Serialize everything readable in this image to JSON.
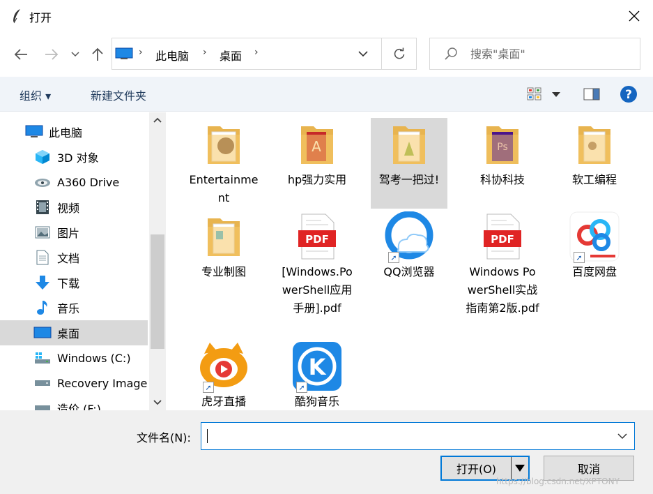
{
  "window": {
    "title": "打开",
    "close_glyph": "✕"
  },
  "address": {
    "crumbs": [
      "此电脑",
      "桌面"
    ],
    "separator": "›"
  },
  "search": {
    "placeholder": "搜索\"桌面\""
  },
  "toolbar": {
    "organize_label": "组织 ▾",
    "new_folder_label": "新建文件夹"
  },
  "sidebar": {
    "items": [
      {
        "label": "此电脑",
        "icon": "computer-icon"
      },
      {
        "label": "3D 对象",
        "icon": "cube-3d-icon"
      },
      {
        "label": "A360 Drive",
        "icon": "cloud-drive-icon"
      },
      {
        "label": "视频",
        "icon": "video-icon"
      },
      {
        "label": "图片",
        "icon": "picture-icon"
      },
      {
        "label": "文档",
        "icon": "document-icon"
      },
      {
        "label": "下载",
        "icon": "download-icon"
      },
      {
        "label": "音乐",
        "icon": "music-icon"
      },
      {
        "label": "桌面",
        "icon": "desktop-icon",
        "selected": true
      },
      {
        "label": "Windows (C:)",
        "icon": "drive-icon"
      },
      {
        "label": "Recovery Image",
        "icon": "drive-icon"
      },
      {
        "label": "造价 (F:)",
        "icon": "drive-icon"
      }
    ]
  },
  "files": [
    {
      "name": "Entertainment",
      "type": "folder"
    },
    {
      "name": "hp强力实用",
      "type": "folder"
    },
    {
      "name": "驾考一把过!",
      "type": "folder",
      "selected": true
    },
    {
      "name": "科协科技",
      "type": "folder"
    },
    {
      "name": "软工编程",
      "type": "folder"
    },
    {
      "name": "专业制图",
      "type": "folder"
    },
    {
      "name": "[Windows.PowerShell应用手册].pdf",
      "type": "pdf",
      "badge": "PDF"
    },
    {
      "name": "QQ浏览器",
      "type": "shortcut"
    },
    {
      "name": "Windows PowerShell实战指南第2版.pdf",
      "type": "pdf",
      "badge": "PDF"
    },
    {
      "name": "百度网盘",
      "type": "shortcut"
    },
    {
      "name": "虎牙直播",
      "type": "shortcut"
    },
    {
      "name": "酷狗音乐",
      "type": "shortcut",
      "badge": "K"
    }
  ],
  "bottom": {
    "filename_label": "文件名(N):",
    "filename_value": "",
    "open_label": "打开(O)",
    "cancel_label": "取消"
  },
  "watermark": "https://blog.csdn.net/XPTONY",
  "colors": {
    "accent": "#0078d7",
    "help": "#1565c0",
    "folder": "#f5c86a",
    "pdf_red": "#e02424"
  }
}
